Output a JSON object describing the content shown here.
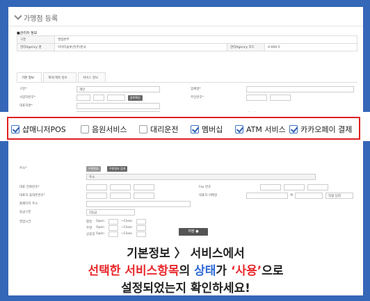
{
  "page": {
    "title": "가맹점 등록",
    "section_label": "■관리자 정보"
  },
  "admin_table": {
    "rows": [
      {
        "label": "구분",
        "value": "영업본부",
        "label2": "",
        "value2": ""
      },
      {
        "label": "관리Agency 명",
        "value": "아이티솔루션(주)본사",
        "label2": "관리Agency 코드",
        "value2": "A-000-5"
      }
    ]
  },
  "tabs": [
    {
      "label": "기본 정보",
      "active": true
    },
    {
      "label": "계약/계좌 정보",
      "active": false
    },
    {
      "label": "서비스 정보",
      "active": false
    }
  ],
  "form": {
    "fields": [
      {
        "label": "구분*",
        "value": "개인",
        "label2": "업체명*",
        "value2": ""
      },
      {
        "label": "사업자번호*",
        "value": "",
        "label2": "주민번호*",
        "value2": "",
        "button": "중복확인"
      },
      {
        "label": "대표자명*",
        "value": "",
        "label2": "",
        "value2": ""
      },
      {
        "label": "VAN사명*",
        "value": "NICE",
        "label2": "고철카드",
        "value2": "Vanity"
      }
    ],
    "address_label": "주소*",
    "address_btn1": "우편번호",
    "address_btn2": "주변정보 검색",
    "address_sub": "주소",
    "phone_label": "대표 전화번호*",
    "fax_label": "Fax 번호",
    "mobile_label": "대표자 휴대폰번호*",
    "email_label": "대표자 이메일",
    "email_at": "@",
    "email_select": "직접 입력",
    "homepage_label": "홈페이지 주소",
    "grade_label": "등급구분",
    "grade_value": "1등급",
    "hours_label": "영업시간",
    "hours_rows": [
      {
        "day": "평일",
        "open": "Open",
        "close": "~Close"
      },
      {
        "day": "주말",
        "open": "Open",
        "close": "~Close"
      },
      {
        "day": "공휴일",
        "open": "Open",
        "close": "~Close"
      }
    ],
    "submit_label": "저장 ●"
  },
  "services": [
    {
      "label": "샵매니저POS",
      "checked": true
    },
    {
      "label": "음원서비스",
      "checked": false
    },
    {
      "label": "대리운전",
      "checked": false
    },
    {
      "label": "멤버십",
      "checked": true
    },
    {
      "label": "ATM 서비스",
      "checked": true
    },
    {
      "label": "카카오페이 결제",
      "checked": true
    }
  ],
  "caption": {
    "line1_a": "기본정보",
    "line1_b": "〉",
    "line1_c": "서비스에서",
    "line2_a": "선택한 서비스항목",
    "line2_b": "의 ",
    "line2_c": "상태",
    "line2_d": "가 ",
    "line2_e": "‘사용’",
    "line2_f": "으로",
    "line3": "설정되었는지 확인하세요!"
  },
  "colors": {
    "frame": "#3567b8",
    "highlight_border": "#e02020",
    "accent_red": "#e8282b",
    "accent_blue": "#2f6bd6"
  }
}
